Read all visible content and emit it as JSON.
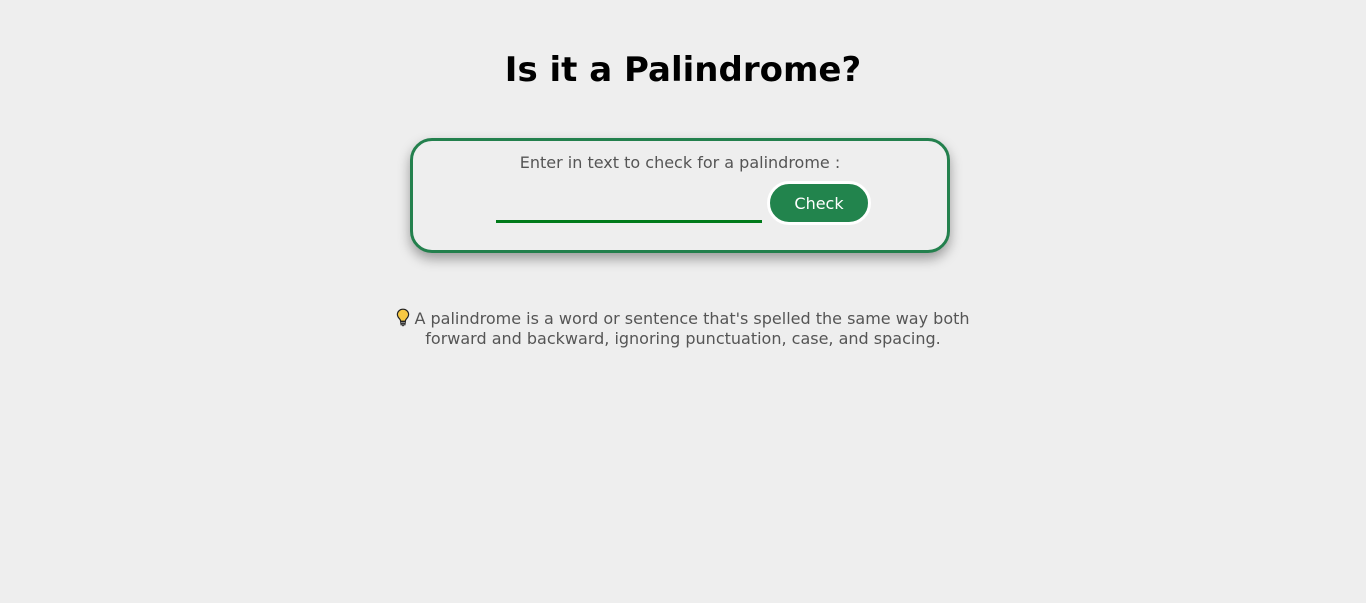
{
  "header": {
    "title": "Is it a Palindrome?"
  },
  "checker": {
    "label": "Enter in text to check for a palindrome :",
    "input_value": "",
    "input_placeholder": "",
    "button_label": "Check"
  },
  "info": {
    "icon": "lightbulb-icon",
    "text": "A palindrome is a word or sentence that's spelled the same way both forward and backward, ignoring punctuation, case, and spacing."
  },
  "colors": {
    "background": "#eeeeee",
    "accent": "#22844d",
    "input_underline": "#007a1a",
    "muted_text": "#555555"
  }
}
